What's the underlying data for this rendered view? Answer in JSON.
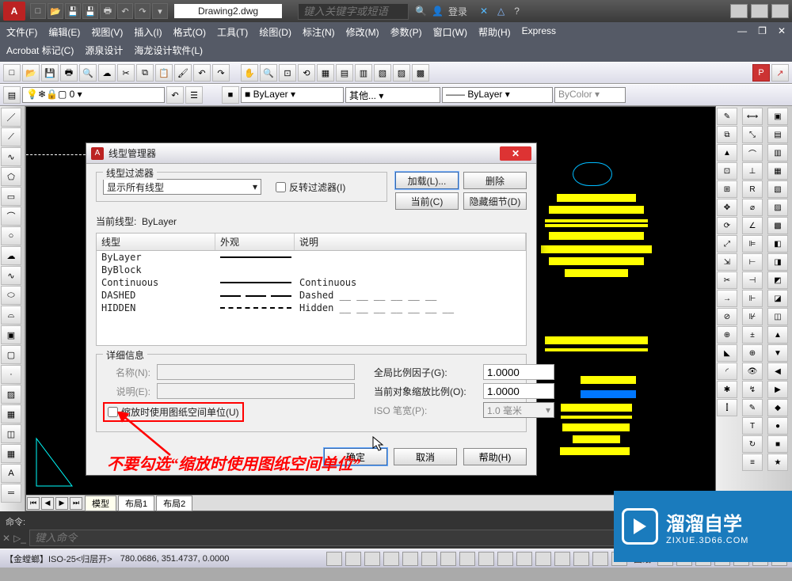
{
  "title_doc": "Drawing2.dwg",
  "search_placeholder": "键入关键字或短语",
  "login_label": "登录",
  "menu": [
    "文件(F)",
    "编辑(E)",
    "视图(V)",
    "插入(I)",
    "格式(O)",
    "工具(T)",
    "绘图(D)",
    "标注(N)",
    "修改(M)",
    "参数(P)",
    "窗口(W)",
    "帮助(H)",
    "Express"
  ],
  "menu2": [
    "Acrobat 标记(C)",
    "源泉设计",
    "海龙设计软件(L)"
  ],
  "prop_layer": "ByLayer",
  "prop_other": "其他...",
  "prop_linetype": "ByLayer",
  "prop_color": "ByColor",
  "tabs": {
    "model": "模型",
    "layout1": "布局1",
    "layout2": "布局2"
  },
  "cmd_label": "命令:",
  "cmd_placeholder": "键入命令",
  "status_left": "【金螳螂】ISO-25<归层开>",
  "status_coords": "780.0686,  351.4737,  0.0000",
  "status_paper": "图纸",
  "dialog": {
    "title": "线型管理器",
    "filter_title": "线型过滤器",
    "filter_value": "显示所有线型",
    "invert_filter": "反转过滤器(I)",
    "btn_load": "加载(L)...",
    "btn_delete": "删除",
    "btn_current": "当前(C)",
    "btn_hide": "隐藏细节(D)",
    "current_label": "当前线型:",
    "current_value": "ByLayer",
    "cols": {
      "c1": "线型",
      "c2": "外观",
      "c3": "说明"
    },
    "rows": [
      {
        "name": "ByLayer",
        "desc": ""
      },
      {
        "name": "ByBlock",
        "desc": ""
      },
      {
        "name": "Continuous",
        "desc": "Continuous"
      },
      {
        "name": "DASHED",
        "desc": "Dashed"
      },
      {
        "name": "HIDDEN",
        "desc": "Hidden"
      }
    ],
    "detail_title": "详细信息",
    "name_label": "名称(N):",
    "desc_label": "说明(E):",
    "scale_label": "缩放时使用图纸空间单位(U)",
    "global_label": "全局比例因子(G):",
    "global_value": "1.0000",
    "objscale_label": "当前对象缩放比例(O):",
    "objscale_value": "1.0000",
    "iso_label": "ISO 笔宽(P):",
    "iso_value": "1.0 毫米",
    "ok": "确定",
    "cancel": "取消",
    "help": "帮助(H)"
  },
  "annotation_text": "不要勾选“缩放时使用图纸空间单位”",
  "watermark": {
    "big": "溜溜自学",
    "small": "ZIXUE.3D66.COM"
  }
}
